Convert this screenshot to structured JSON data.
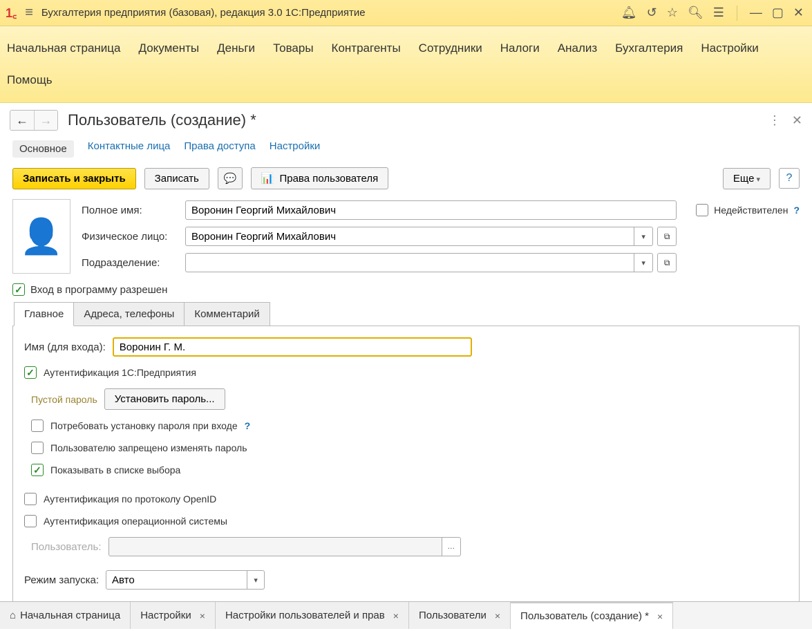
{
  "titlebar": {
    "title": "Бухгалтерия предприятия (базовая), редакция 3.0 1С:Предприятие"
  },
  "menubar": {
    "items": [
      "Начальная страница",
      "Документы",
      "Деньги",
      "Товары",
      "Контрагенты",
      "Сотрудники",
      "Налоги",
      "Анализ",
      "Бухгалтерия",
      "Настройки",
      "Помощь"
    ]
  },
  "page": {
    "title": "Пользователь (создание) *"
  },
  "view_tabs": [
    "Основное",
    "Контактные лица",
    "Права доступа",
    "Настройки"
  ],
  "toolbar": {
    "write_close": "Записать и закрыть",
    "write": "Записать",
    "rights": "Права пользователя",
    "more": "Еще",
    "help": "?"
  },
  "fields": {
    "fullname_label": "Полное имя:",
    "fullname_value": "Воронин Георгий Михайлович",
    "person_label": "Физическое лицо:",
    "person_value": "Воронин Георгий Михайлович",
    "dept_label": "Подразделение:",
    "dept_value": "",
    "invalid_label": "Недействителен",
    "allow_login_label": "Вход в программу разрешен"
  },
  "inner_tabs": [
    "Главное",
    "Адреса, телефоны",
    "Комментарий"
  ],
  "main_tab": {
    "login_label": "Имя (для входа):",
    "login_value": "Воронин Г. М.",
    "auth_1c": "Аутентификация 1С:Предприятия",
    "empty_password": "Пустой пароль",
    "set_password": "Установить пароль...",
    "require_pw_change": "Потребовать установку пароля при входе",
    "forbid_pw_change": "Пользователю запрещено изменять пароль",
    "show_in_list": "Показывать в списке выбора",
    "auth_openid": "Аутентификация по протоколу OpenID",
    "auth_os": "Аутентификация операционной системы",
    "os_user_label": "Пользователь:",
    "launch_mode_label": "Режим запуска:",
    "launch_mode_value": "Авто"
  },
  "bottom_tabs": [
    {
      "label": "Начальная страница",
      "closable": false,
      "home": true
    },
    {
      "label": "Настройки",
      "closable": true
    },
    {
      "label": "Настройки пользователей и прав",
      "closable": true
    },
    {
      "label": "Пользователи",
      "closable": true
    },
    {
      "label": "Пользователь (создание) *",
      "closable": true,
      "active": true
    }
  ]
}
